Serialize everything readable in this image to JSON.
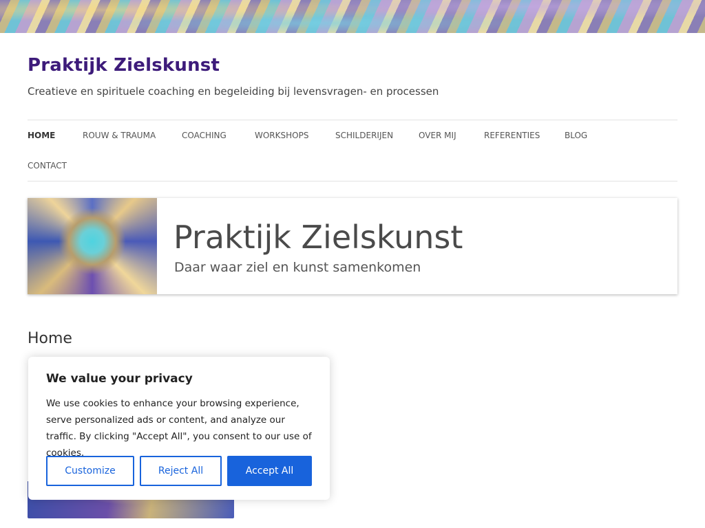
{
  "site": {
    "title": "Praktijk Zielskunst",
    "description": "Creatieve en spirituele coaching en begeleiding bij levensvragen- en processen"
  },
  "nav": {
    "items": [
      {
        "label": "Home",
        "active": true
      },
      {
        "label": "Rouw & Trauma"
      },
      {
        "label": "Coaching"
      },
      {
        "label": "Workshops"
      },
      {
        "label": "Schilderijen"
      },
      {
        "label": "Over mij"
      },
      {
        "label": "Referenties"
      },
      {
        "label": "Blog"
      },
      {
        "label": "Contact"
      }
    ]
  },
  "banner": {
    "title": "Praktijk Zielskunst",
    "subtitle": "Daar waar ziel en kunst samenkomen"
  },
  "page": {
    "title": "Home"
  },
  "cookie": {
    "title": "We value your privacy",
    "text": "We use cookies to enhance your browsing experience, serve personalized ads or content, and analyze our traffic. By clicking \"Accept All\", you consent to our use of cookies.",
    "customize_label": "Customize",
    "reject_label": "Reject All",
    "accept_label": "Accept All"
  },
  "colors": {
    "title": "#3d1b7a",
    "accent": "#1863dc"
  }
}
